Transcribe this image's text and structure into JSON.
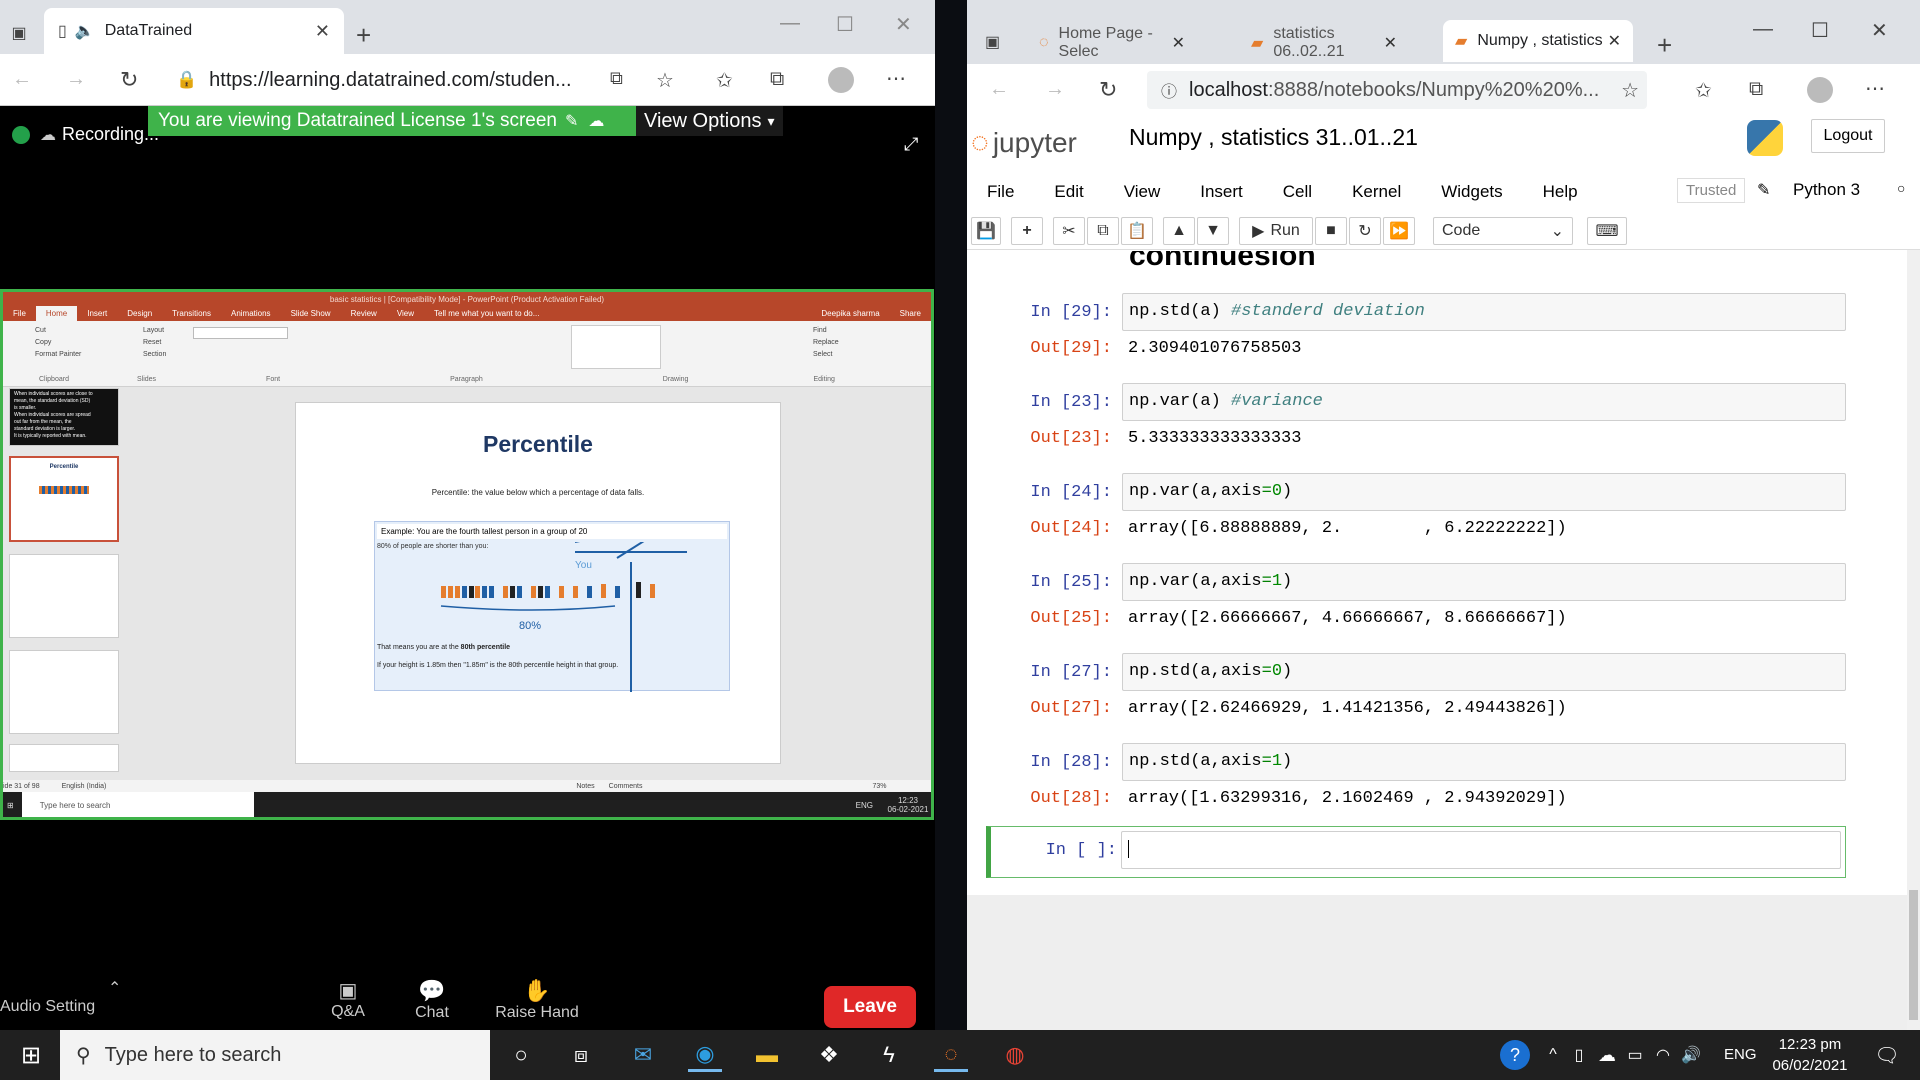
{
  "left_browser": {
    "tab_title": "DataTrained",
    "url": "https://learning.datatrained.com/studen...",
    "recording_label": "Recording...",
    "share_banner": "You are viewing Datatrained License 1's screen",
    "view_options": "View Options"
  },
  "powerpoint": {
    "title": "basic statistics | [Compatibility Mode] - PowerPoint (Product Activation Failed)",
    "user": "Deepika sharma",
    "share": "Share",
    "tabs": [
      "File",
      "Home",
      "Insert",
      "Design",
      "Transitions",
      "Animations",
      "Slide Show",
      "Review",
      "View"
    ],
    "tell_me": "Tell me what you want to do...",
    "groups": [
      "Clipboard",
      "Slides",
      "Font",
      "Paragraph",
      "Drawing",
      "Editing"
    ],
    "clipboard_items": [
      "Cut",
      "Copy",
      "Format Painter"
    ],
    "slides_items": [
      "Layout",
      "Reset",
      "Section"
    ],
    "editing_items": [
      "Find",
      "Replace",
      "Select"
    ],
    "slide": {
      "heading": "Percentile",
      "definition": "Percentile: the value below which a percentage of data falls.",
      "example": "Example: You are the fourth tallest person in a group of 20",
      "shorter": "80% of people are shorter than you:",
      "you": "You",
      "pct": "80%",
      "means_prefix": "That means you are at the",
      "means_bold": "80th percentile",
      "height": "If your height is 1.85m then \"1.85m\" is the 80th percentile height in that group."
    },
    "thumb1_lines": [
      "When individual scores are close to",
      "mean, the standard deviation (SD)",
      "is smaller.",
      "When individual scores are spread",
      "out far from the mean, the",
      "standard deviation is larger.",
      "It is typically reported with mean."
    ],
    "thumb2_title": "Percentile",
    "status_slide": "ide 31 of 98",
    "status_lang": "English (India)",
    "status_notes": "Notes",
    "status_comments": "Comments",
    "status_zoom": "73%",
    "inner_search": "Type here to search",
    "inner_time": "12:23",
    "inner_date": "06-02-2021",
    "inner_lang": "ENG"
  },
  "zoom_controls": {
    "audio": "Audio Setting",
    "qa": "Q&A",
    "chat": "Chat",
    "raise": "Raise Hand",
    "leave": "Leave"
  },
  "right_browser": {
    "tabs": [
      "Home Page - Selec",
      "statistics 06..02..21",
      "Numpy , statistics"
    ],
    "url_host": "localhost",
    "url_rest": ":8888/notebooks/Numpy%20%20%...",
    "logo_text": "jupyter",
    "notebook_title": "Numpy , statistics 31..01..21",
    "logout": "Logout",
    "menu": [
      "File",
      "Edit",
      "View",
      "Insert",
      "Cell",
      "Kernel",
      "Widgets",
      "Help"
    ],
    "trusted": "Trusted",
    "kernel": "Python 3",
    "run": "Run",
    "cell_type": "Code",
    "partial_heading": "continuesion"
  },
  "cells": [
    {
      "in": "In [29]:",
      "code": "np.std(a) ",
      "comment": "#standerd deviation",
      "out": "Out[29]:",
      "result": "2.309401076758503"
    },
    {
      "in": "In [23]:",
      "code": "np.var(a) ",
      "comment": "#variance",
      "out": "Out[23]:",
      "result": "5.333333333333333"
    },
    {
      "in": "In [24]:",
      "code_a": "np.var(a,axis",
      "code_b": "0",
      "out": "Out[24]:",
      "result": "array([6.88888889, 2.        , 6.22222222])"
    },
    {
      "in": "In [25]:",
      "code_a": "np.var(a,axis",
      "code_b": "1",
      "out": "Out[25]:",
      "result": "array([2.66666667, 4.66666667, 8.66666667])"
    },
    {
      "in": "In [27]:",
      "code_a": "np.std(a,axis",
      "code_b": "0",
      "out": "Out[27]:",
      "result": "array([2.62466929, 1.41421356, 2.49443826])"
    },
    {
      "in": "In [28]:",
      "code_a": "np.std(a,axis",
      "code_b": "1",
      "out": "Out[28]:",
      "result": "array([1.63299316, 2.1602469 , 2.94392029])"
    },
    {
      "in": "In [ ]:"
    }
  ],
  "taskbar": {
    "search": "Type here to search",
    "lang": "ENG",
    "time": "12:23 pm",
    "date": "06/02/2021"
  }
}
